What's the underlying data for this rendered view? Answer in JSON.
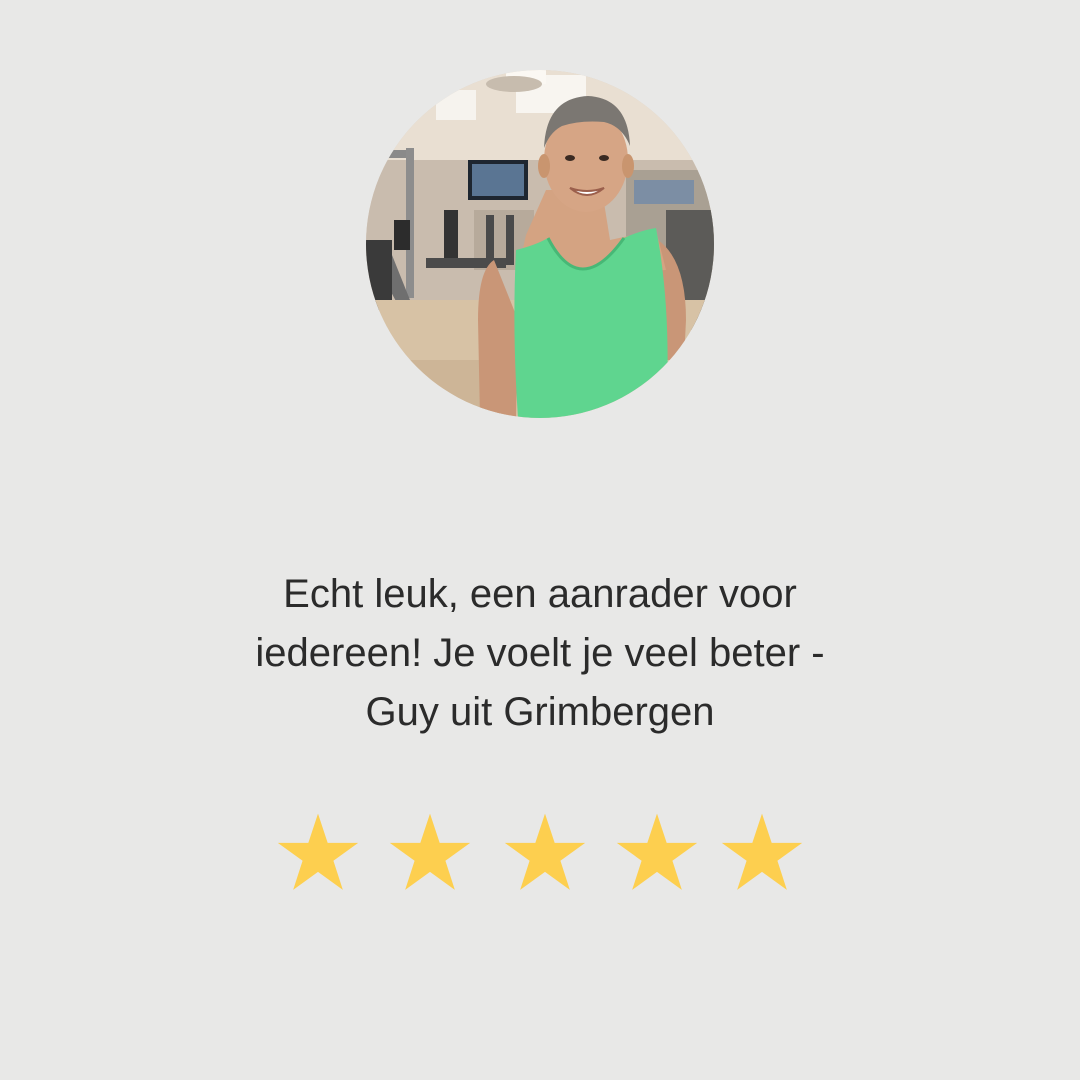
{
  "review": {
    "quote_lines": [
      "Echt leuk, een aanrader voor",
      "iedereen! Je voelt je veel beter -",
      "Guy uit Grimbergen"
    ],
    "rating": 5,
    "rating_max": 5
  },
  "photo": {
    "subject": "smiling man in green tank top in a gym"
  },
  "colors": {
    "background": "#e8e8e7",
    "text": "#2b2b2b",
    "star": "#fdcf4f",
    "shirt": "#5fd58f"
  },
  "icons": {
    "rating": "star-icon"
  }
}
